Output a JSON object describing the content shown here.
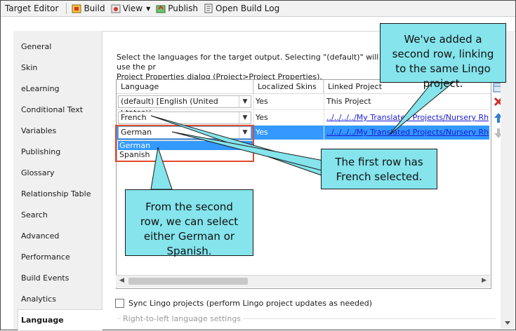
{
  "toolbar": {
    "title": "Target Editor",
    "build": "Build",
    "view": "View",
    "publish": "Publish",
    "open_build_log": "Open Build Log"
  },
  "sidebar": {
    "items": [
      {
        "label": "General"
      },
      {
        "label": "Skin"
      },
      {
        "label": "eLearning"
      },
      {
        "label": "Conditional Text"
      },
      {
        "label": "Variables"
      },
      {
        "label": "Publishing"
      },
      {
        "label": "Glossary"
      },
      {
        "label": "Relationship Table"
      },
      {
        "label": "Search"
      },
      {
        "label": "Advanced"
      },
      {
        "label": "Performance"
      },
      {
        "label": "Build Events"
      },
      {
        "label": "Analytics"
      }
    ],
    "active": "Language"
  },
  "main": {
    "description_line1": "Select the languages for the target output. Selecting \"(default)\" will use the pr",
    "description_line2": "Project Properties dialog (Project>Project Properties).",
    "table": {
      "headers": [
        "Language",
        "Localized Skins",
        "Linked Project"
      ],
      "rows": [
        {
          "language": "(default) [English (United States)]",
          "skins": "Yes",
          "project": "This Project",
          "project_link": false
        },
        {
          "language": "French",
          "skins": "Yes",
          "project": "../../../../My Translated Projects/Nursery Rhyme",
          "project_link": true
        },
        {
          "language": "German",
          "skins": "Yes",
          "project": "../../../../My Translated Projects/Nursery Rhyme",
          "project_link": true
        }
      ]
    },
    "dropdown_options": [
      "German",
      "Spanish"
    ],
    "sync_label": "Sync Lingo projects (perform Lingo project updates as needed)",
    "rtl_label": "Right-to-left language settings"
  },
  "callouts": {
    "top": "We've added a second row, linking to the same Lingo project.",
    "middle": "The first row has French selected.",
    "bottom": "From the second row, we can select either German or Spanish."
  },
  "colors": {
    "callout_fill": "#85e4ec",
    "selection": "#3399ff",
    "highlight_border": "#e04a2c",
    "link": "#1a1ad6"
  },
  "icons": {
    "build": "build-icon",
    "view": "view-icon",
    "publish": "publish-icon",
    "build_log": "log-icon",
    "add_row": "add-row-icon",
    "delete_row": "delete-icon",
    "move_up": "arrow-up-icon",
    "move_down": "arrow-down-icon"
  }
}
